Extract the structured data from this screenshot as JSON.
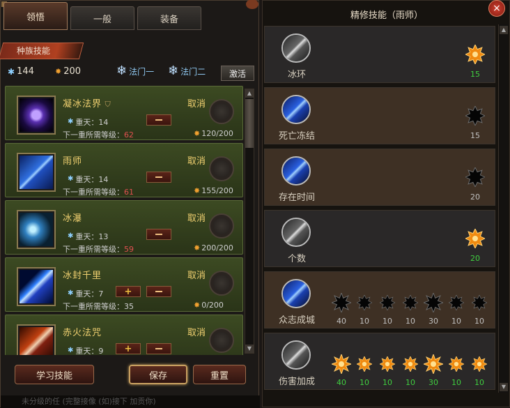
{
  "left": {
    "tabs": [
      "领悟",
      "一般",
      "装备"
    ],
    "race_tab": "种族技能",
    "resources": {
      "ice_points": "144",
      "fire_points": "200"
    },
    "talents": {
      "one": "法门一",
      "two": "法门二"
    },
    "activate": "激活",
    "cards": [
      {
        "name": "凝冰法界",
        "has_shield": true,
        "cancel": "取消",
        "level_label": "重天：14",
        "next_label": "下一重所需等级：",
        "next_val": "62",
        "cost": "120/200",
        "buttons": "minus",
        "icon": "rune"
      },
      {
        "name": "雨师",
        "cancel": "取消",
        "level_label": "重天：14",
        "next_label": "下一重所需等级：",
        "next_val": "61",
        "cost": "155/200",
        "buttons": "minus",
        "icon": "rain"
      },
      {
        "name": "冰瀑",
        "cancel": "取消",
        "level_label": "重天：13",
        "next_label": "下一重所需等级：",
        "next_val": "59",
        "cost": "200/200",
        "buttons": "minus",
        "icon": "shard"
      },
      {
        "name": "冰封千里",
        "cancel": "取消",
        "level_label": "重天：7",
        "next_label": "下一重所需等级：",
        "next_val": "35",
        "next_plain": true,
        "cost": "0/200",
        "buttons": "both",
        "icon": "bolt"
      },
      {
        "name": "赤火法咒",
        "cancel": "取消",
        "level_label": "重天：9",
        "next_label": "",
        "next_val": "",
        "cost": "",
        "buttons": "both",
        "icon": "fire"
      }
    ],
    "buttons": {
      "learn": "学习技能",
      "save": "保存",
      "reset": "重置"
    },
    "bottom_text": "未分级的任 (完整接像 (如)接下 加贡你)"
  },
  "right": {
    "title": "精修技能（雨师）",
    "close": "×",
    "rows": [
      {
        "label": "冰环",
        "style": "dark",
        "icon": "gray",
        "stars": [
          {
            "v": "15",
            "lit": true
          }
        ]
      },
      {
        "label": "死亡冻结",
        "style": "brown",
        "icon": "blue",
        "stars": [
          {
            "v": "15",
            "lit": false
          }
        ]
      },
      {
        "label": "存在时间",
        "style": "brown",
        "icon": "blue",
        "stars": [
          {
            "v": "20",
            "lit": false
          }
        ]
      },
      {
        "label": "个数",
        "style": "dark",
        "icon": "gray",
        "stars": [
          {
            "v": "20",
            "lit": true
          }
        ]
      },
      {
        "label": "众志成城",
        "style": "brown",
        "icon": "blue",
        "stars": [
          {
            "v": "40",
            "lit": false,
            "big": true
          },
          {
            "v": "10",
            "lit": false
          },
          {
            "v": "10",
            "lit": false
          },
          {
            "v": "10",
            "lit": false
          },
          {
            "v": "30",
            "lit": false,
            "big": true
          },
          {
            "v": "10",
            "lit": false
          },
          {
            "v": "10",
            "lit": false
          }
        ]
      },
      {
        "label": "伤害加成",
        "style": "dark",
        "icon": "gray",
        "stars": [
          {
            "v": "40",
            "lit": true,
            "big": true
          },
          {
            "v": "10",
            "lit": true
          },
          {
            "v": "10",
            "lit": true
          },
          {
            "v": "10",
            "lit": true
          },
          {
            "v": "30",
            "lit": true,
            "big": true
          },
          {
            "v": "10",
            "lit": true
          },
          {
            "v": "10",
            "lit": true
          }
        ]
      }
    ]
  }
}
